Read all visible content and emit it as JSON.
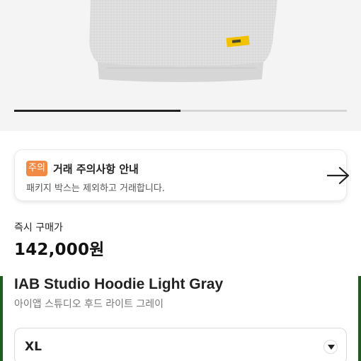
{
  "gallery": {
    "image_alt": "IAB Studio Hoodie Light Gray",
    "progress_fraction": 0.5
  },
  "notice": {
    "badge": "주의",
    "title": "거래 주의사항 안내",
    "description": "패키지 박스는 제외하고 거래합니다.",
    "arrow_icon": "arrow-right-icon"
  },
  "price": {
    "label": "즉시 구매가",
    "value": "142,000원"
  },
  "product": {
    "name_en": "IAB Studio Hoodie Light Gray",
    "name_ko": "아이앱 스튜디오 후드 라이트 그레이"
  },
  "size_select": {
    "selected": "XL",
    "chevron_icon": "chevron-down-icon"
  },
  "colors": {
    "badge": "#f08a45",
    "accent_side": "#1f5a1f",
    "hoodie": "#dcdcdc",
    "tag": "#f2c200"
  }
}
